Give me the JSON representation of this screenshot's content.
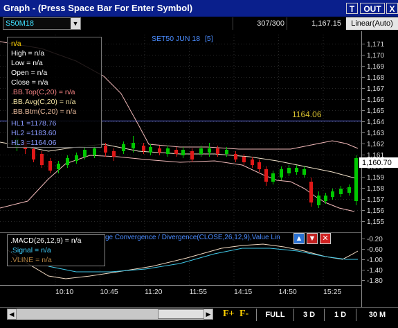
{
  "window": {
    "title": "Graph - (Press Space Bar For Enter Symbol)",
    "btn_t": "T",
    "btn_out": "OUT",
    "btn_x": "X"
  },
  "toolbar": {
    "symbol": "S50M18",
    "count": "307/300",
    "price": "1,167.15",
    "scale": "Linear(Auto)"
  },
  "chart": {
    "title": "SET50 JUN 18",
    "title_num": "[5]",
    "level_label": "1164.06",
    "last_price_tag": "1,160.70",
    "yticks": [
      "1,171",
      "1,170",
      "1,169",
      "1,168",
      "1,167",
      "1,166",
      "1,165",
      "1,164",
      "1,163",
      "1,162",
      "1,161",
      "1,160",
      "1,159",
      "1,158",
      "1,157",
      "1,156",
      "1,155"
    ],
    "macd_yticks": [
      "-0.20",
      "-0.60",
      "-1.00",
      "-1.40",
      "-1.80"
    ],
    "xticks": [
      "10:10",
      "10:45",
      "11:20",
      "11:55",
      "14:15",
      "14:50",
      "15:25"
    ]
  },
  "info": {
    "name": "n/a",
    "rows": [
      "High  = n/a",
      "Low   = n/a",
      "Open  = n/a",
      "Close  = n/a"
    ],
    "bb": [
      ".BB.Top(C,20)    = n/a",
      ".BB.Avg(C,20)    = n/a",
      ".BB.Btm(C,20)    = n/a"
    ],
    "hl": [
      "HL1 =1178.76",
      "HL2 =1183.60",
      "HL3 =1164.06"
    ]
  },
  "macd": {
    "rows": [
      ".MACD(26,12,9)    = n/a",
      ".Signal  = n/a",
      ".VLINE   = n/a"
    ],
    "desc": "ge Convergence / Divergence(CLOSE,26,12,9),Value Lin"
  },
  "bottom": {
    "zoom_in": "F+",
    "zoom_out": "F-",
    "periods": [
      "FULL",
      "3 D",
      "1 D",
      "30 M"
    ]
  },
  "colors": {
    "title_bg": "#0a1f8c",
    "up": "#00c800",
    "down": "#e01818",
    "bb": "#f0b0b0",
    "macd": "#ffffff",
    "signal": "#3fc0e0"
  }
}
